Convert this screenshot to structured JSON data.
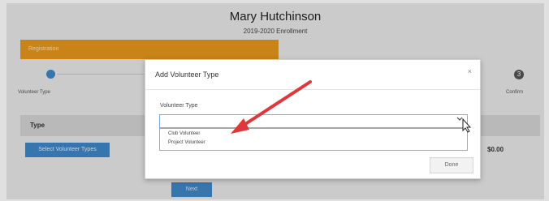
{
  "header": {
    "name": "Mary Hutchinson",
    "subtitle": "2019-2020 Enrollment"
  },
  "registration_bar": {
    "label": "Registration",
    "color": "#e4961d"
  },
  "steps": {
    "left_label": "Volunteer Type",
    "right_label": "Confirm",
    "right_number": "3"
  },
  "table": {
    "type_header": "Type",
    "select_button": "Select Volunteer Types",
    "amount": "$0.00"
  },
  "next_button": "Next",
  "modal": {
    "title": "Add Volunteer Type",
    "close_symbol": "×",
    "field_label": "Volunteer Type",
    "selected_value": "",
    "options": [
      "Club Volunteer",
      "Project Volunteer"
    ],
    "done_button": "Done"
  },
  "colors": {
    "accent_blue": "#3f86c6",
    "arrow_red": "#e0373a",
    "page_bg": "#e7e7e7"
  },
  "icons": {
    "close": "close-icon",
    "caret": "chevron-down-icon",
    "cursor": "mouse-cursor-icon",
    "arrow": "red-arrow-annotation"
  }
}
